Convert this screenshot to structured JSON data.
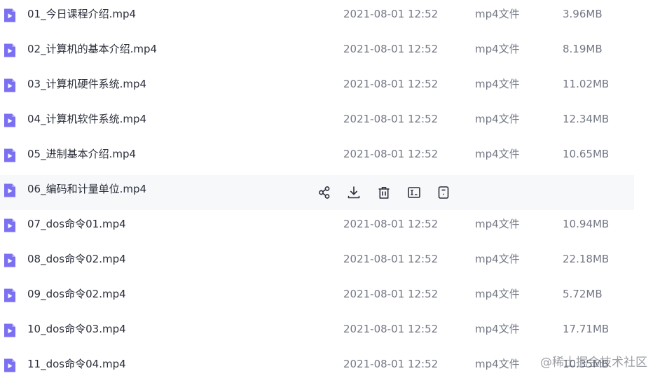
{
  "colors": {
    "icon_purple": "#7c70f2",
    "hover_row_background": "#f7f8fa",
    "action_icon": "#2b2f3a"
  },
  "file_icon": "video-file-icon",
  "files": [
    {
      "name": "01_今日课程介绍.mp4",
      "date": "2021-08-01 12:52",
      "type": "mp4文件",
      "size": "3.96MB"
    },
    {
      "name": "02_计算机的基本介绍.mp4",
      "date": "2021-08-01 12:52",
      "type": "mp4文件",
      "size": "8.19MB"
    },
    {
      "name": "03_计算机硬件系统.mp4",
      "date": "2021-08-01 12:52",
      "type": "mp4文件",
      "size": "11.02MB"
    },
    {
      "name": "04_计算机软件系统.mp4",
      "date": "2021-08-01 12:52",
      "type": "mp4文件",
      "size": "12.34MB"
    },
    {
      "name": "05_进制基本介绍.mp4",
      "date": "2021-08-01 12:52",
      "type": "mp4文件",
      "size": "10.65MB"
    },
    {
      "name": "06_编码和计量单位.mp4"
    },
    {
      "name": "07_dos命令01.mp4",
      "date": "2021-08-01 12:52",
      "type": "mp4文件",
      "size": "10.94MB"
    },
    {
      "name": "08_dos命令02.mp4",
      "date": "2021-08-01 12:52",
      "type": "mp4文件",
      "size": "22.18MB"
    },
    {
      "name": "09_dos命令02.mp4",
      "date": "2021-08-01 12:52",
      "type": "mp4文件",
      "size": "5.72MB"
    },
    {
      "name": "10_dos命令03.mp4",
      "date": "2021-08-01 12:52",
      "type": "mp4文件",
      "size": "17.71MB"
    },
    {
      "name": "11_dos命令04.mp4",
      "date": "2021-08-01 12:52",
      "type": "mp4文件",
      "size": "10.35MB"
    }
  ],
  "hover_actions": [
    "share-icon",
    "download-icon",
    "delete-icon",
    "rename-icon",
    "more-icon"
  ],
  "watermark": "@稀土掘金技术社区"
}
